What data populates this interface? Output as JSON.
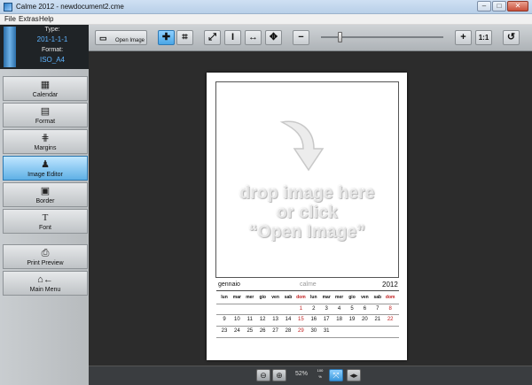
{
  "window": {
    "title": "Calme 2012 - newdocument2.cme",
    "min": "–",
    "max": "□",
    "close": "✕"
  },
  "menu": [
    "File",
    "Extras",
    "Help"
  ],
  "info": {
    "type_label": "Type:",
    "type_value": "201-1-1-1",
    "format_label": "Format:",
    "format_value": "ISO_A4"
  },
  "toolbar": {
    "open_image_label": "Open Image",
    "one_to_one_label": "1:1",
    "zoom_slider_value": 0.15
  },
  "sidebar": [
    {
      "label": "Calendar",
      "icon": "calendar-icon"
    },
    {
      "label": "Format",
      "icon": "format-icon"
    },
    {
      "label": "Margins",
      "icon": "margins-icon"
    },
    {
      "label": "Image Editor",
      "icon": "image-editor-icon",
      "active": true
    },
    {
      "label": "Border",
      "icon": "border-icon"
    },
    {
      "label": "Font",
      "icon": "font-icon"
    },
    {
      "label": "Print Preview",
      "icon": "print-preview-icon"
    },
    {
      "label": "Main Menu",
      "icon": "main-menu-icon"
    }
  ],
  "canvas": {
    "drop_line1": "drop image here",
    "drop_line2": "or click",
    "drop_line3": "“Open Image”"
  },
  "calendar": {
    "month": "gennaio",
    "brand": "calme",
    "year": "2012",
    "daynames": [
      "lun",
      "mar",
      "mer",
      "gio",
      "ven",
      "sab",
      "dom",
      "lun",
      "mar",
      "mer",
      "gio",
      "ven",
      "sab",
      "dom"
    ],
    "row1": [
      "",
      "",
      "",
      "",
      "",
      "",
      "1",
      "2",
      "3",
      "4",
      "5",
      "6",
      "7",
      "8"
    ],
    "row2": [
      "9",
      "10",
      "11",
      "12",
      "13",
      "14",
      "15",
      "16",
      "17",
      "18",
      "19",
      "20",
      "21",
      "22"
    ],
    "row3": [
      "23",
      "24",
      "25",
      "26",
      "27",
      "28",
      "29",
      "30",
      "31",
      "",
      "",
      "",
      "",
      ""
    ]
  },
  "statusbar": {
    "zoom_value": "52%",
    "fit_label_top": "100",
    "fit_label_bottom": "%"
  }
}
